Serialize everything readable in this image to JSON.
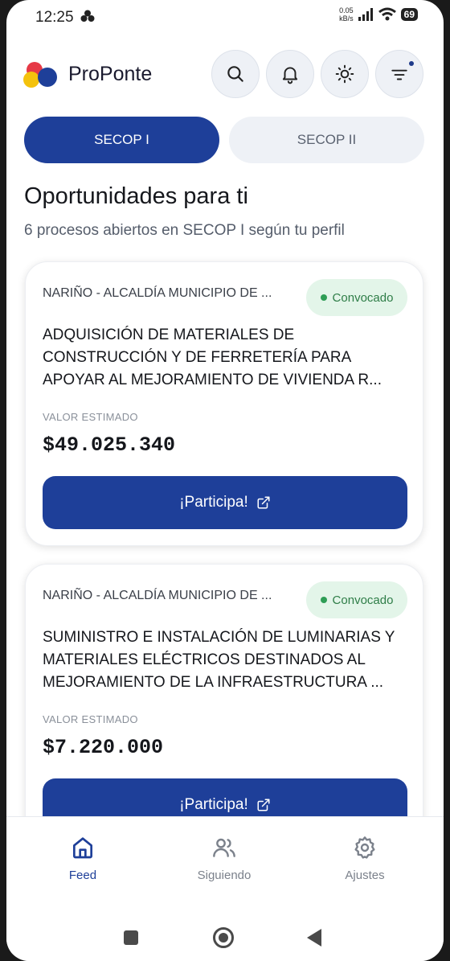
{
  "status_bar": {
    "time": "12:25",
    "net_speed_value": "0.05",
    "net_speed_unit": "kB/s",
    "battery": "69"
  },
  "header": {
    "brand": "ProPonte",
    "logo_colors": [
      "#e63946",
      "#f4c20d",
      "#1e3f99"
    ],
    "actions": [
      "search-icon",
      "bell-icon",
      "sun-icon",
      "filter-icon"
    ]
  },
  "tabs": [
    {
      "label": "SECOP I",
      "active": true
    },
    {
      "label": "SECOP II",
      "active": false
    }
  ],
  "section": {
    "title": "Oportunidades para ti",
    "subtitle": "6 procesos abiertos en SECOP I según tu perfil"
  },
  "cards": [
    {
      "entity": "NARIÑO - ALCALDÍA MUNICIPIO DE ...",
      "status": "Convocado",
      "title": "ADQUISICIÓN DE MATERIALES DE CONSTRUCCIÓN Y DE FERRETERÍA PARA APOYAR AL MEJORAMIENTO DE VIVIENDA R...",
      "value_label": "VALOR ESTIMADO",
      "value": "$49.025.340",
      "cta": "¡Participa!"
    },
    {
      "entity": "NARIÑO - ALCALDÍA MUNICIPIO DE ...",
      "status": "Convocado",
      "title": "SUMINISTRO E INSTALACIÓN DE LUMINARIAS Y MATERIALES ELÉCTRICOS DESTINADOS AL MEJORAMIENTO DE LA INFRAESTRUCTURA ...",
      "value_label": "VALOR ESTIMADO",
      "value": "$7.220.000",
      "cta": "¡Participa!"
    }
  ],
  "bottom_nav": [
    {
      "label": "Feed",
      "icon": "home-icon",
      "active": true
    },
    {
      "label": "Siguiendo",
      "icon": "users-icon",
      "active": false
    },
    {
      "label": "Ajustes",
      "icon": "gear-icon",
      "active": false
    }
  ],
  "colors": {
    "primary": "#1e3f99",
    "badge_bg": "#e3f5e9",
    "badge_text": "#2e7d47"
  }
}
